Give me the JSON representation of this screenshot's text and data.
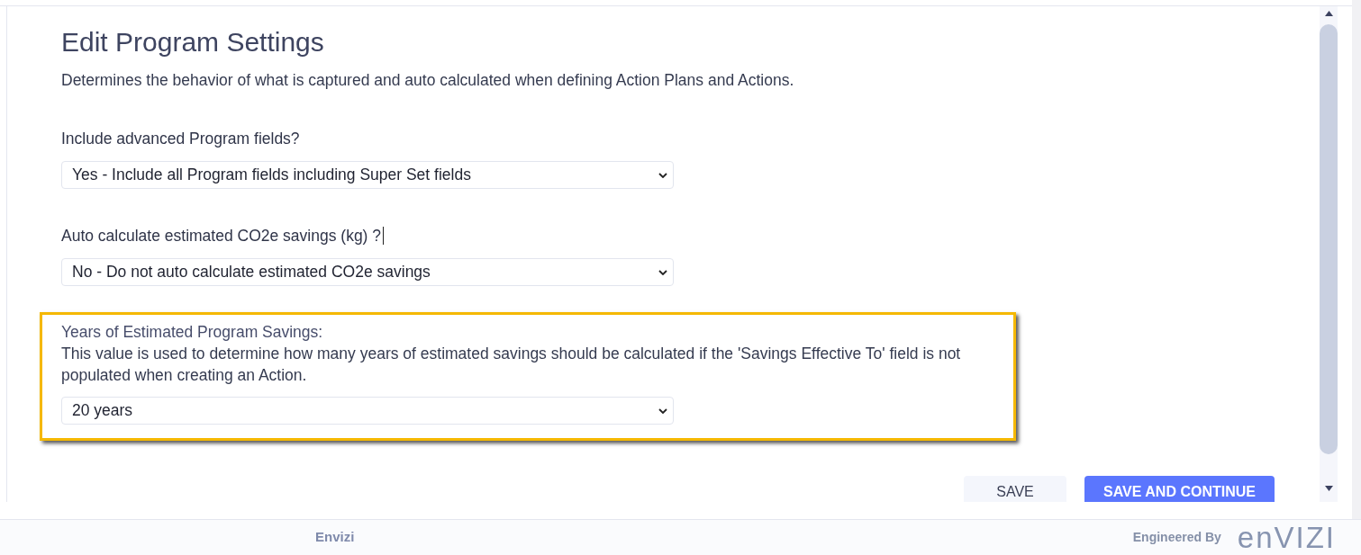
{
  "header": {
    "title": "Edit Program Settings",
    "description": "Determines the behavior of what is captured and auto calculated when defining Action Plans and Actions."
  },
  "settings": [
    {
      "label": "Include advanced Program fields?",
      "value": "Yes - Include all Program fields including Super Set fields",
      "highlighted": false,
      "text_cursor": false
    },
    {
      "label": "Auto calculate estimated CO2e savings (kg) ?",
      "value": "No - Do not auto calculate estimated CO2e savings",
      "highlighted": false,
      "text_cursor": true
    },
    {
      "label": "Years of Estimated Program Savings:",
      "help": "This value is used to determine how many years of estimated savings should be calculated if the 'Savings Effective To' field is not populated when creating an Action.",
      "value": "20 years",
      "highlighted": true,
      "text_cursor": false
    }
  ],
  "buttons": [
    {
      "label": "SAVE",
      "kind": "secondary"
    },
    {
      "label": "SAVE AND CONTINUE",
      "kind": "primary"
    }
  ],
  "footer": {
    "brand": "Envizi",
    "engineered_by": "Engineered By",
    "logo": "enVIZI"
  }
}
